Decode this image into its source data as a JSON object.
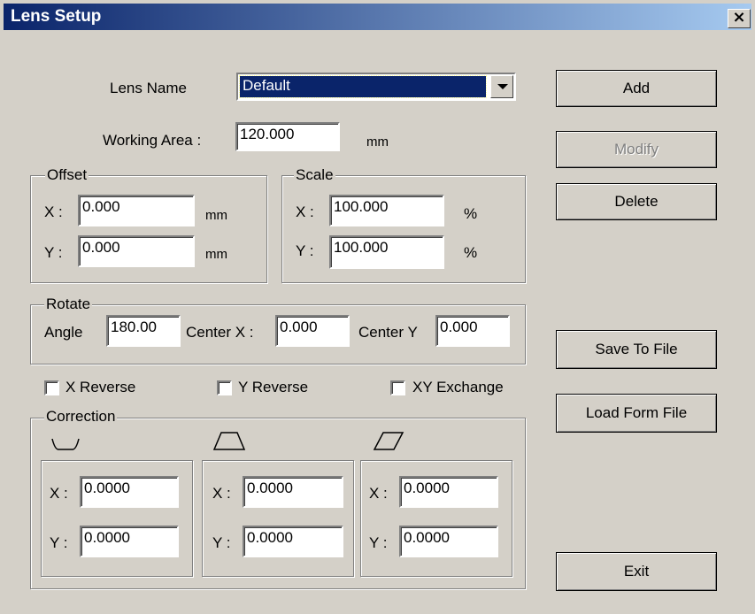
{
  "window": {
    "title": "Lens Setup",
    "close_glyph": "×"
  },
  "lens_name": {
    "label": "Lens Name",
    "value": "Default"
  },
  "working_area": {
    "label": "Working Area :",
    "value": "120.000",
    "unit": "mm"
  },
  "offset": {
    "title": "Offset",
    "x_label": "X :",
    "x_value": "0.000",
    "y_label": "Y :",
    "y_value": "0.000",
    "unit": "mm"
  },
  "scale": {
    "title": "Scale",
    "x_label": "X :",
    "x_value": "100.000",
    "y_label": "Y :",
    "y_value": "100.000",
    "unit": "%"
  },
  "rotate": {
    "title": "Rotate",
    "angle_label": "Angle",
    "angle_value": "180.00",
    "center_x_label": "Center X :",
    "center_x_value": "0.000",
    "center_y_label": "Center Y",
    "center_y_value": "0.000"
  },
  "checkboxes": {
    "x_reverse": "X Reverse",
    "y_reverse": "Y Reverse",
    "xy_exchange": "XY Exchange"
  },
  "correction": {
    "title": "Correction",
    "barrel": {
      "icon": "barrel-distortion-icon",
      "x_label": "X :",
      "x_value": "0.0000",
      "y_label": "Y :",
      "y_value": "0.0000"
    },
    "trapezoid": {
      "icon": "trapezoid-icon",
      "x_label": "X :",
      "x_value": "0.0000",
      "y_label": "Y :",
      "y_value": "0.0000"
    },
    "parallelogram": {
      "icon": "parallelogram-icon",
      "x_label": "X :",
      "x_value": "0.0000",
      "y_label": "Y :",
      "y_value": "0.0000"
    }
  },
  "buttons": {
    "add": "Add",
    "modify": "Modify",
    "delete": "Delete",
    "save_to_file": "Save To File",
    "load_form_file": "Load Form File",
    "exit": "Exit"
  },
  "colors": {
    "title_bar_start": "#0a246a",
    "title_bar_end": "#a6caf0",
    "dialog_face": "#d4d0c8",
    "disabled_text": "#808080"
  }
}
